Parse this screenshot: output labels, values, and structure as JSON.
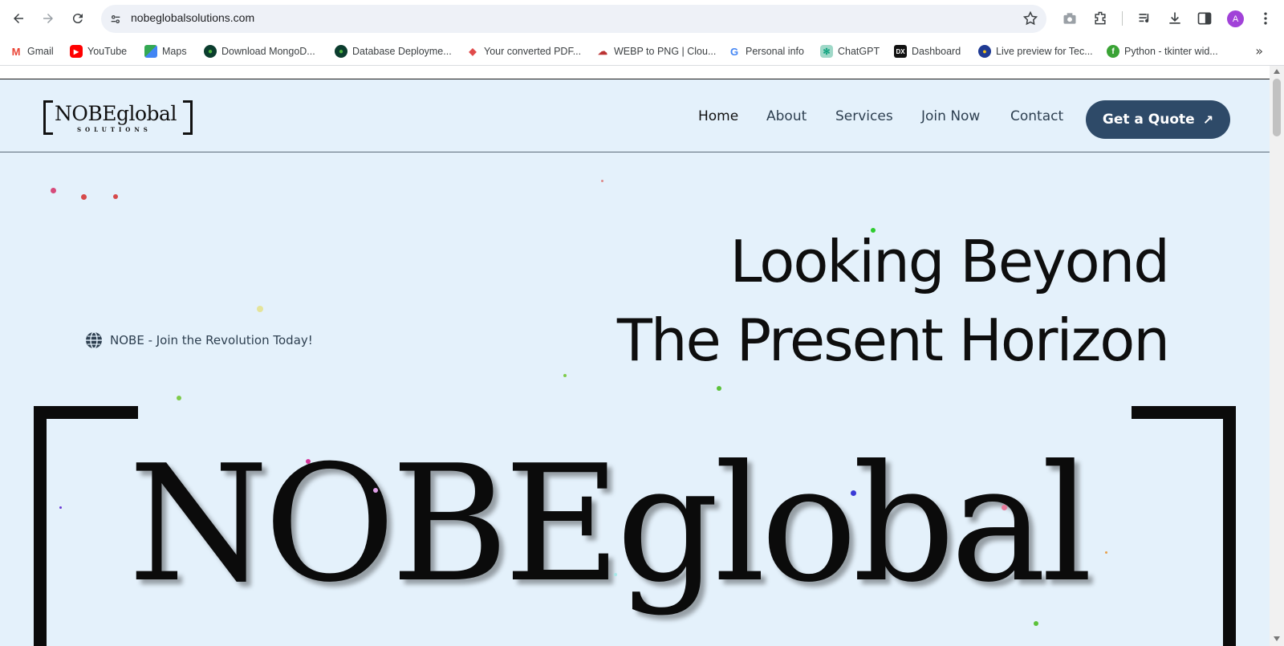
{
  "browser": {
    "url": "nobeglobalsolutions.com",
    "avatar_letter": "A",
    "bookmarks": [
      {
        "label": "Gmail",
        "icon": "gmail-icon",
        "color": "#ea4335"
      },
      {
        "label": "YouTube",
        "icon": "youtube-icon",
        "color": "#ff0000"
      },
      {
        "label": "Maps",
        "icon": "maps-icon",
        "color": "#34a853"
      },
      {
        "label": "Download MongoD...",
        "icon": "mongodb-icon",
        "color": "#0b3d2e"
      },
      {
        "label": "Database Deployme...",
        "icon": "mongodb-icon",
        "color": "#0b3d2e"
      },
      {
        "label": "Your converted PDF...",
        "icon": "pdf-icon",
        "color": "#e04b4b"
      },
      {
        "label": "WEBP to PNG | Clou...",
        "icon": "cloud-icon",
        "color": "#b33"
      },
      {
        "label": "Personal info",
        "icon": "google-icon",
        "color": "#4285f4"
      },
      {
        "label": "ChatGPT",
        "icon": "chatgpt-icon",
        "color": "#10a37f"
      },
      {
        "label": "Dashboard",
        "icon": "dx-icon",
        "color": "#111111"
      },
      {
        "label": "Live preview for Tec...",
        "icon": "preview-icon",
        "color": "#1f3a93"
      },
      {
        "label": "Python - tkinter wid...",
        "icon": "python-icon",
        "color": "#3aa335"
      }
    ]
  },
  "site": {
    "logo_word": "NOBEglobal",
    "logo_sub": "SOLUTIONS",
    "nav": [
      "Home",
      "About",
      "Services",
      "Join Now",
      "Contact"
    ],
    "cta": "Get a Quote",
    "cta_arrow": "↗",
    "hero_line1": "Looking Beyond",
    "hero_line2": "The Present Horizon",
    "tagline": "NOBE - Join the Revolution Today!",
    "big_logo": "NOBEglobal",
    "accent": "#2e4a68",
    "bg": "#e4f1fb"
  }
}
